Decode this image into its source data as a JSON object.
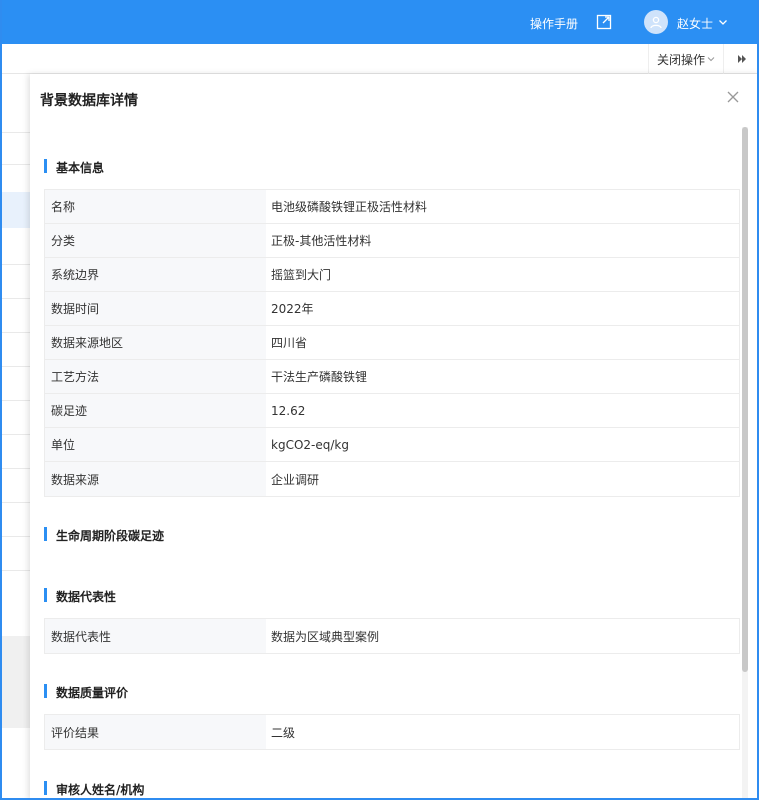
{
  "header": {
    "manual_label": "操作手册",
    "user_name": "赵女士",
    "accent_color": "#2b8ff3"
  },
  "subbar": {
    "close_ops_label": "关闭操作"
  },
  "drawer": {
    "title": "背景数据库详情",
    "sections": {
      "basic": {
        "title": "基本信息",
        "rows": [
          {
            "key": "名称",
            "value": "电池级磷酸铁锂正极活性材料"
          },
          {
            "key": "分类",
            "value": "正极-其他活性材料"
          },
          {
            "key": "系统边界",
            "value": "摇篮到大门"
          },
          {
            "key": "数据时间",
            "value": "2022年"
          },
          {
            "key": "数据来源地区",
            "value": "四川省"
          },
          {
            "key": "工艺方法",
            "value": "干法生产磷酸铁锂"
          },
          {
            "key": "碳足迹",
            "value": "12.62"
          },
          {
            "key": "单位",
            "value": "kgCO2-eq/kg"
          },
          {
            "key": "数据来源",
            "value": "企业调研"
          }
        ]
      },
      "lifecycle": {
        "title": "生命周期阶段碳足迹"
      },
      "representativeness": {
        "title": "数据代表性",
        "rows": [
          {
            "key": "数据代表性",
            "value": "数据为区域典型案例"
          }
        ]
      },
      "quality": {
        "title": "数据质量评价",
        "rows": [
          {
            "key": "评价结果",
            "value": "二级"
          }
        ]
      },
      "reviewer": {
        "title": "审核人姓名/机构"
      }
    }
  }
}
